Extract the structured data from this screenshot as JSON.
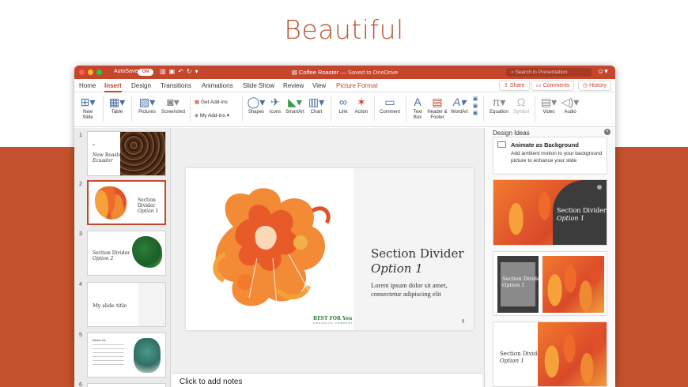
{
  "headline": "Beautiful",
  "window": {
    "autosave_label": "AutoSave",
    "autosave_toggle": "ON",
    "doc_title": "Coffee Roaster",
    "save_status": "— Saved to OneDrive",
    "search_placeholder": "Search in Presentation"
  },
  "tabs": [
    "Home",
    "Insert",
    "Design",
    "Transitions",
    "Animations",
    "Slide Show",
    "Review",
    "View",
    "Picture Format"
  ],
  "active_tab": "Insert",
  "tab_buttons": {
    "share": "Share",
    "comments": "Comments",
    "history": "History"
  },
  "ribbon": {
    "new_slide": "New\nSlide",
    "table": "Table",
    "pictures": "Pictures",
    "screenshot": "Screenshot",
    "get_addins": "Get Add-ins",
    "my_addins": "My Add-ins",
    "shapes": "Shapes",
    "icons": "Icons",
    "smartart": "SmartArt",
    "chart": "Chart",
    "link": "Link",
    "action": "Action",
    "comment": "Comment",
    "text_box": "Text\nBox",
    "header_footer": "Header &\nFooter",
    "wordart": "WordArt",
    "equation": "Equation",
    "symbol": "Symbol",
    "video": "Video",
    "audio": "Audio"
  },
  "thumbnails": {
    "numbers": [
      "1",
      "2",
      "3",
      "4",
      "5",
      "6"
    ],
    "slide1_title": "New Roaster",
    "slide1_sub": "Ecuador",
    "slide2_title": "Section Divider",
    "slide2_sub": "Option 1",
    "slide3_title": "Section Divider",
    "slide3_sub": "Option 2",
    "slide4_title": "My slide title",
    "slide5_title": "About Us"
  },
  "slide": {
    "title": "Section Divider",
    "subtitle": "Option 1",
    "body": "Lorem ipsum dolor sit amet, consectetur adipiscing elit",
    "logo": "BEST FOR You",
    "logo_sub": "ORGANICS COMPANY"
  },
  "notes_placeholder": "Click to add notes",
  "design_ideas": {
    "header": "Design Ideas",
    "anim_title": "Animate as Background",
    "anim_desc": "Add ambient motion to your background picture to enhance your slide",
    "card1_title": "Section Divider",
    "card1_sub": "Option 1",
    "card2_title": "Section Divider",
    "card2_sub": "Option 1",
    "card3_title": "Section Divider",
    "card3_sub": "Option 1"
  },
  "colors": {
    "accent": "#c4462c",
    "band": "#c4512d",
    "headline": "#b9542f"
  }
}
